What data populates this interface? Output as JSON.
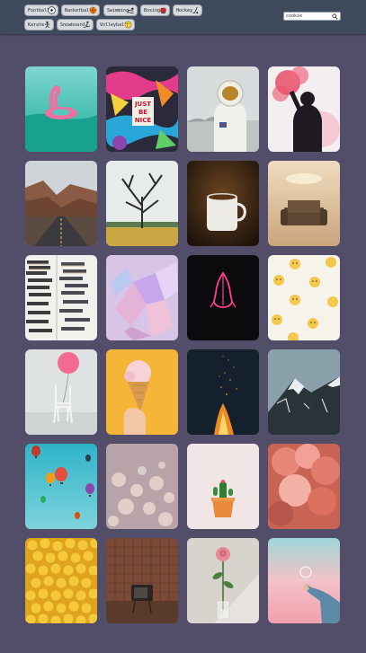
{
  "categories": [
    {
      "label": "Football",
      "icon": "soccer-ball-icon"
    },
    {
      "label": "Basketball",
      "icon": "basketball-icon"
    },
    {
      "label": "Swimming",
      "icon": "swimmer-icon"
    },
    {
      "label": "Boxing",
      "icon": "boxing-icon"
    },
    {
      "label": "Hockey",
      "icon": "hockey-icon"
    },
    {
      "label": "Karate",
      "icon": "karate-icon"
    },
    {
      "label": "Snowboard",
      "icon": "snowboard-icon"
    },
    {
      "label": "Volleyball",
      "icon": "volleyball-icon"
    }
  ],
  "search": {
    "value": "cookie"
  },
  "gallery": [
    {
      "subject": "flamingo-float"
    },
    {
      "subject": "just-be-nice-graffiti",
      "text": [
        "JUST",
        "BE",
        "NICE"
      ]
    },
    {
      "subject": "astronaut"
    },
    {
      "subject": "red-smoke-flare"
    },
    {
      "subject": "desert-road"
    },
    {
      "subject": "bare-tree"
    },
    {
      "subject": "coffee-mug"
    },
    {
      "subject": "old-armchair"
    },
    {
      "subject": "book-stacks"
    },
    {
      "subject": "pink-crystals"
    },
    {
      "subject": "neon-praying-hands"
    },
    {
      "subject": "egg-emoji-pattern"
    },
    {
      "subject": "pink-balloon-chair"
    },
    {
      "subject": "ice-cream-cone"
    },
    {
      "subject": "campfire-sparks"
    },
    {
      "subject": "snowy-mountain"
    },
    {
      "subject": "hot-air-balloons"
    },
    {
      "subject": "bokeh-lights"
    },
    {
      "subject": "potted-cactus"
    },
    {
      "subject": "pink-clouds"
    },
    {
      "subject": "emoji-balls-pile"
    },
    {
      "subject": "vintage-tv"
    },
    {
      "subject": "rose-in-vase"
    },
    {
      "subject": "hand-lightbulb"
    }
  ]
}
